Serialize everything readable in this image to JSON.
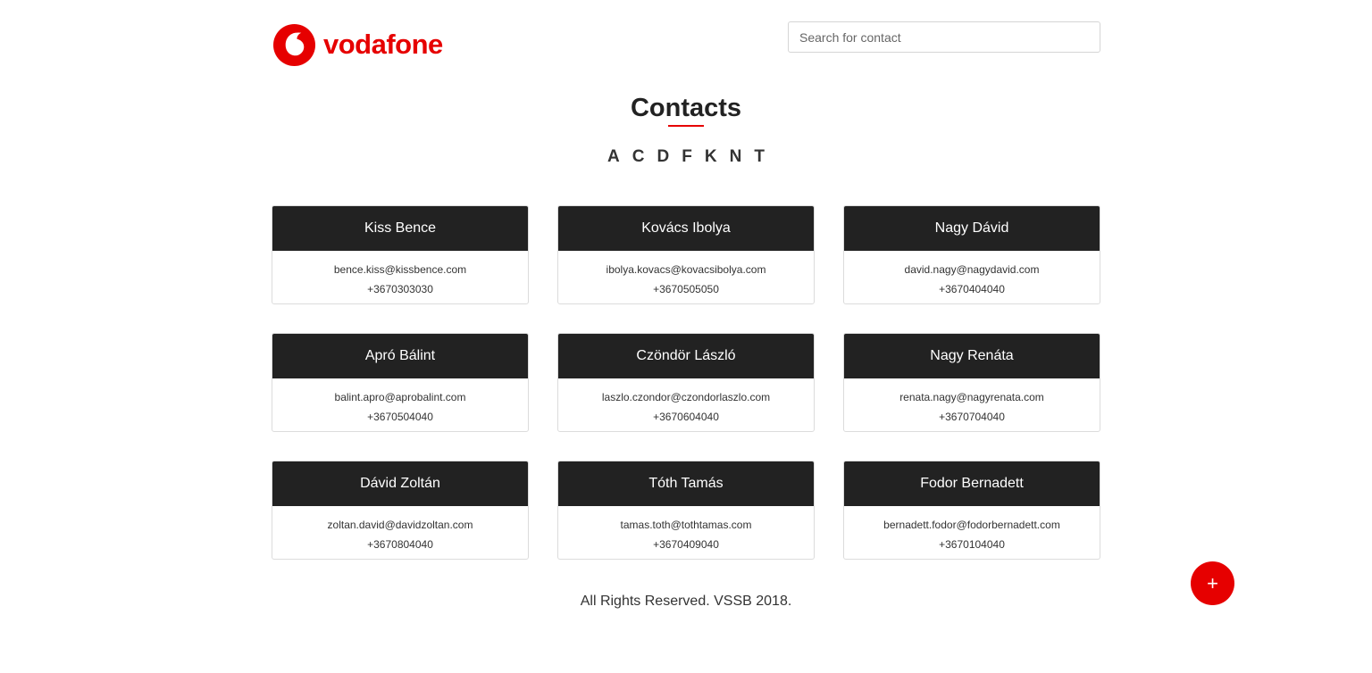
{
  "brand": {
    "name": "vodafone",
    "color": "#e60000",
    "logo_icon": "vodafone-speechmark-icon"
  },
  "search": {
    "placeholder": "Search for contact",
    "value": ""
  },
  "page": {
    "title": "Contacts"
  },
  "letters": [
    "A",
    "C",
    "D",
    "F",
    "K",
    "N",
    "T"
  ],
  "contacts": [
    {
      "name": "Kiss Bence",
      "email": "bence.kiss@kissbence.com",
      "phone": "+3670303030"
    },
    {
      "name": "Kovács Ibolya",
      "email": "ibolya.kovacs@kovacsibolya.com",
      "phone": "+3670505050"
    },
    {
      "name": "Nagy Dávid",
      "email": "david.nagy@nagydavid.com",
      "phone": "+3670404040"
    },
    {
      "name": "Apró Bálint",
      "email": "balint.apro@aprobalint.com",
      "phone": "+3670504040"
    },
    {
      "name": "Czöndör László",
      "email": "laszlo.czondor@czondorlaszlo.com",
      "phone": "+3670604040"
    },
    {
      "name": "Nagy Renáta",
      "email": "renata.nagy@nagyrenata.com",
      "phone": "+3670704040"
    },
    {
      "name": "Dávid Zoltán",
      "email": "zoltan.david@davidzoltan.com",
      "phone": "+3670804040"
    },
    {
      "name": "Tóth Tamás",
      "email": "tamas.toth@tothtamas.com",
      "phone": "+3670409040"
    },
    {
      "name": "Fodor Bernadett",
      "email": "bernadett.fodor@fodorbernadett.com",
      "phone": "+3670104040"
    }
  ],
  "footer": {
    "text": "All Rights Reserved. VSSB 2018."
  },
  "add_button": {
    "label": "+",
    "icon": "plus-icon"
  }
}
